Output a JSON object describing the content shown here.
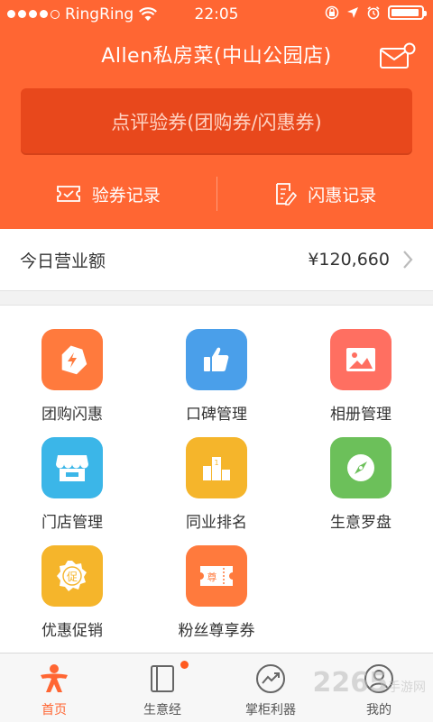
{
  "status_bar": {
    "carrier": "RingRing",
    "time": "22:05"
  },
  "header": {
    "store_name": "Allen私房菜(中山公园店)"
  },
  "verify_button": {
    "label": "点评验券(团购券/闪惠券)"
  },
  "records": [
    {
      "label": "验券记录",
      "icon": "ticket-check-icon"
    },
    {
      "label": "闪惠记录",
      "icon": "receipt-edit-icon"
    }
  ],
  "revenue": {
    "label": "今日营业额",
    "value": "¥120,660"
  },
  "tiles": [
    {
      "label": "团购闪惠",
      "icon": "tag-bolt-icon",
      "color": "#ff7a3d"
    },
    {
      "label": "口碑管理",
      "icon": "thumbs-up-icon",
      "color": "#4a9fea"
    },
    {
      "label": "相册管理",
      "icon": "photo-icon",
      "color": "#ff6f61"
    },
    {
      "label": "门店管理",
      "icon": "storefront-icon",
      "color": "#3bb6e8"
    },
    {
      "label": "同业排名",
      "icon": "podium-icon",
      "color": "#f5b52b"
    },
    {
      "label": "生意罗盘",
      "icon": "compass-icon",
      "color": "#6cc05a"
    },
    {
      "label": "优惠促销",
      "icon": "promo-badge-icon",
      "color": "#f5b52b"
    },
    {
      "label": "粉丝尊享券",
      "icon": "vip-ticket-icon",
      "color": "#ff7a3d"
    }
  ],
  "tabbar": [
    {
      "label": "首页",
      "icon": "home-person-icon",
      "active": true
    },
    {
      "label": "生意经",
      "icon": "book-icon",
      "active": false,
      "badge": true
    },
    {
      "label": "掌柜利器",
      "icon": "trend-icon",
      "active": false
    },
    {
      "label": "我的",
      "icon": "user-icon",
      "active": false
    }
  ],
  "watermark": {
    "main": "2265",
    "sub": "手游网"
  }
}
